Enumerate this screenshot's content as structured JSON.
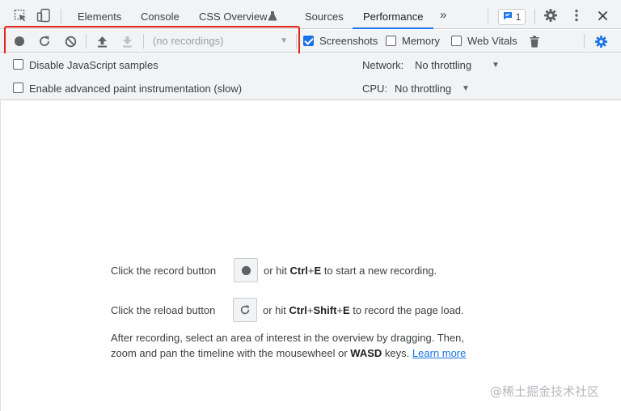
{
  "tabs": [
    {
      "label": "Elements"
    },
    {
      "label": "Console"
    },
    {
      "label": "CSS Overview"
    },
    {
      "label": "Sources"
    },
    {
      "label": "Performance"
    }
  ],
  "more_tabs_glyph": "»",
  "issues_count": "1",
  "recording_select": {
    "value": "(no recordings)"
  },
  "toolbar_checkboxes": [
    {
      "label": "Screenshots",
      "checked": true
    },
    {
      "label": "Memory",
      "checked": false
    },
    {
      "label": "Web Vitals",
      "checked": false
    }
  ],
  "settings": {
    "disable_js_samples": {
      "label": "Disable JavaScript samples",
      "checked": false
    },
    "advanced_paint": {
      "label": "Enable advanced paint instrumentation (slow)",
      "checked": false
    },
    "network_label": "Network:",
    "network_value": "No throttling",
    "cpu_label": "CPU:",
    "cpu_value": "No throttling"
  },
  "instructions": {
    "line1_pre": "Click the record button",
    "line1_mid": "or hit",
    "line1_k1": "Ctrl",
    "line1_plus": "+",
    "line1_k2": "E",
    "line1_post": "to start a new recording.",
    "line2_pre": "Click the reload button",
    "line2_mid": "or hit",
    "line2_k1": "Ctrl",
    "line2_plus1": "+",
    "line2_k2": "Shift",
    "line2_plus2": "+",
    "line2_k3": "E",
    "line2_post": "to record the page load.",
    "line3": "After recording, select an area of interest in the overview by dragging. Then,",
    "line4_pre": "zoom and pan the timeline with the mousewheel or",
    "line4_keys": "WASD",
    "line4_post": "keys.",
    "learn_more": "Learn more"
  },
  "watermark": "@稀土掘金技术社区",
  "colors": {
    "accent": "#1a73e8",
    "highlight": "#e0261f"
  }
}
